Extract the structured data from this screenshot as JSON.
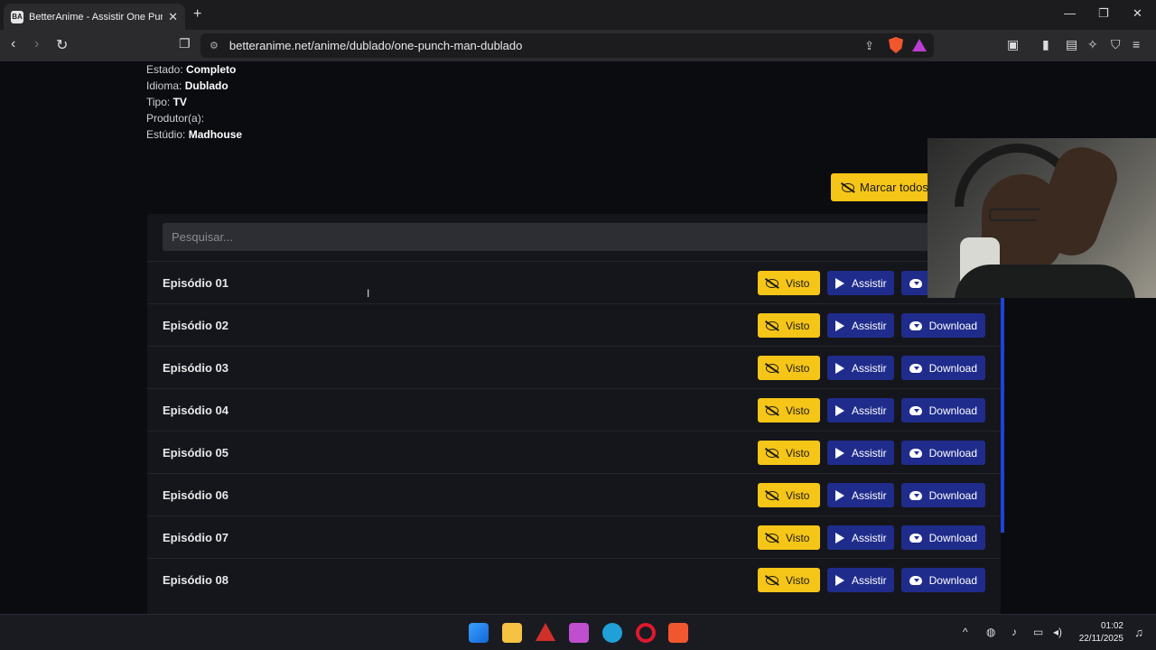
{
  "browser": {
    "tab_title": "BetterAnime - Assistir One Punch",
    "tab_icon": "BA",
    "url": "betteranime.net/anime/dublado/one-punch-man-dublado"
  },
  "info": {
    "estado_label": "Estado:",
    "estado_value": "Completo",
    "idioma_label": "Idioma:",
    "idioma_value": "Dublado",
    "tipo_label": "Tipo:",
    "tipo_value": "TV",
    "produtor_label": "Produtor(a):",
    "estudio_label": "Estúdio:",
    "estudio_value": "Madhouse"
  },
  "mark_all_label": "Marcar todos",
  "search": {
    "placeholder": "Pesquisar..."
  },
  "episodes": [
    {
      "title": "Episódio 01"
    },
    {
      "title": "Episódio 02"
    },
    {
      "title": "Episódio 03"
    },
    {
      "title": "Episódio 04"
    },
    {
      "title": "Episódio 05"
    },
    {
      "title": "Episódio 06"
    },
    {
      "title": "Episódio 07"
    },
    {
      "title": "Episódio 08"
    }
  ],
  "buttons": {
    "visto": "Visto",
    "assistir": "Assistir",
    "download": "Download"
  },
  "taskbar": {
    "time": "01:02",
    "date": "22/11/2025"
  },
  "colors": {
    "accent_yellow": "#f5c518",
    "accent_blue": "#1f2c8c",
    "scroll": "#1d43d8"
  }
}
